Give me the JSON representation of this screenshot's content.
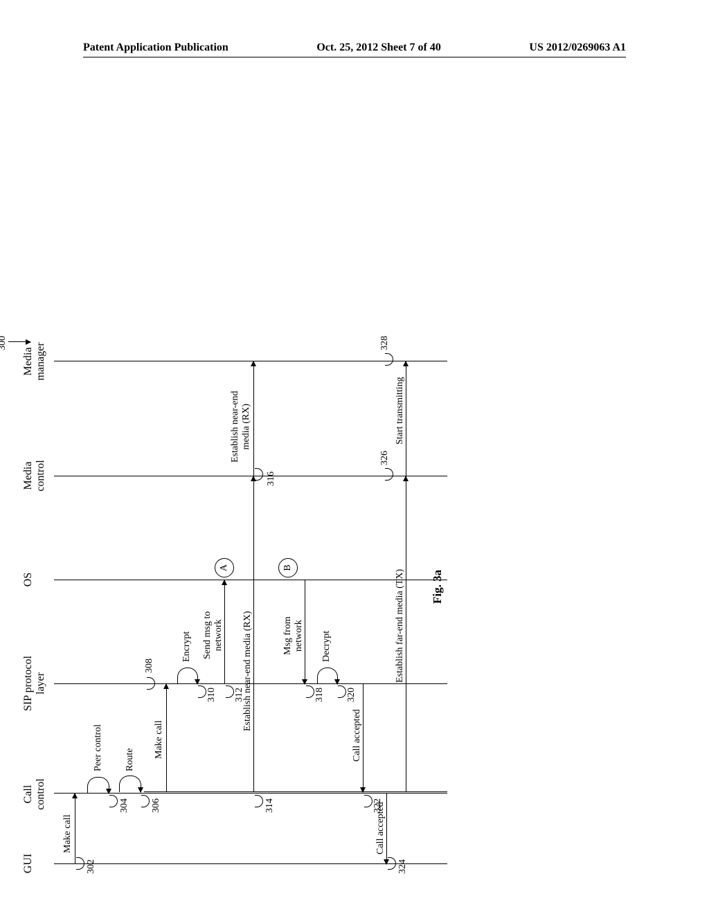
{
  "header": {
    "left": "Patent Application Publication",
    "center": "Oct. 25, 2012  Sheet 7 of 40",
    "right": "US 2012/0269063 A1"
  },
  "diagram": {
    "ref300": "300",
    "lifelines": {
      "gui": "GUI",
      "call_control": "Call\ncontrol",
      "sip": "SIP protocol\nlayer",
      "os": "OS",
      "media_control": "Media\ncontrol",
      "media_manager": "Media\nmanager"
    },
    "msgs": {
      "make_call_1": "Make call",
      "peer_control": "Peer control",
      "route": "Route",
      "make_call_2": "Make call",
      "encrypt": "Encrypt",
      "send_msg": "Send msg to\nnetwork",
      "est_near_end_1": "Establish near-end media (RX)",
      "est_near_end_2": "Establish near-end\nmedia (RX)",
      "msg_from_net": "Msg from\nnetwork",
      "decrypt": "Decrypt",
      "call_accepted_1": "Call accepted",
      "call_accepted_2": "Call accepted",
      "est_far_end": "Establish far-end media (TX)",
      "start_tx": "Start transmitting"
    },
    "refs": {
      "r302": "302",
      "r304": "304",
      "r306": "306",
      "r308": "308",
      "r310": "310",
      "r312": "312",
      "r314": "314",
      "r316": "316",
      "r318": "318",
      "r320": "320",
      "r322": "322",
      "r324": "324",
      "r326": "326",
      "r328": "328"
    },
    "nodes": {
      "A": "A",
      "B": "B"
    },
    "fignum": "Fig. 3a"
  }
}
